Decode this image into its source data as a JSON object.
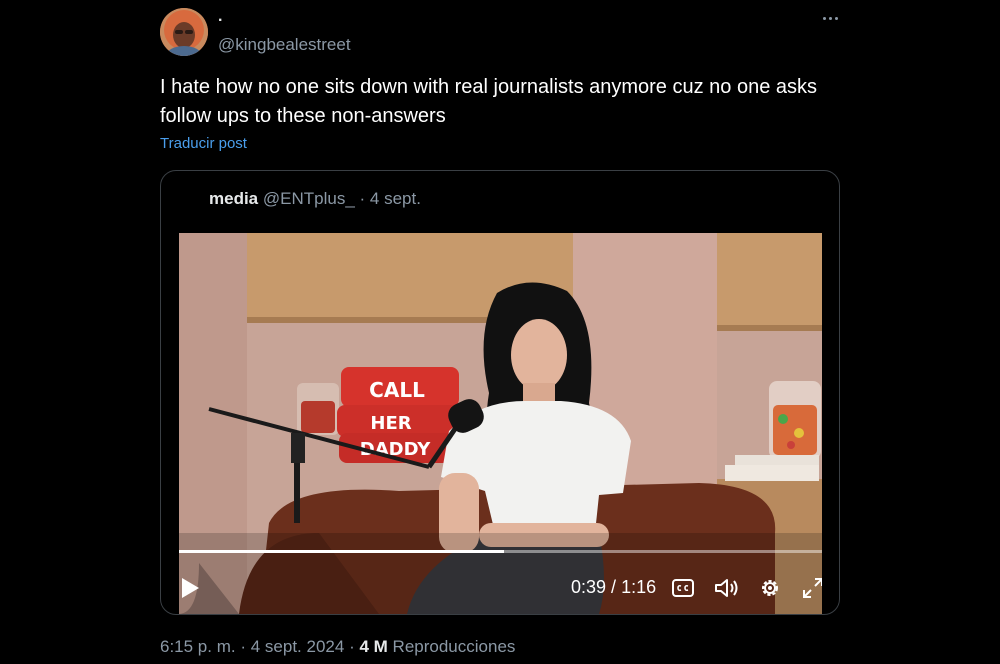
{
  "tweet": {
    "display_name": ".",
    "handle": "@kingbealestreet",
    "text": "I hate how no one sits down with real journalists anymore cuz no one asks follow ups to these non-answers",
    "translate_label": "Traducir post",
    "more_icon": "more-horizontal-icon"
  },
  "quote": {
    "name": "media",
    "handle": "@ENTplus_",
    "separator": "·",
    "date": "4 sept.",
    "video": {
      "sign_lines": [
        "CALL",
        "HER",
        "DADDY"
      ],
      "current_time": "0:39",
      "time_separator": " / ",
      "duration": "1:16",
      "progress_fraction": 0.506,
      "icons": [
        "play-icon",
        "captions-icon",
        "volume-icon",
        "settings-icon",
        "fullscreen-icon"
      ]
    }
  },
  "meta": {
    "time": "6:15 p. m.",
    "separator": "·",
    "date": "4 sept. 2024",
    "views_count": "4 M",
    "views_label": "Reproducciones"
  },
  "colors": {
    "background": "#000000",
    "text_primary": "#e7e9ea",
    "text_secondary": "#8b98a5",
    "link": "#4a9eec",
    "card_border": "#3a3f44"
  }
}
